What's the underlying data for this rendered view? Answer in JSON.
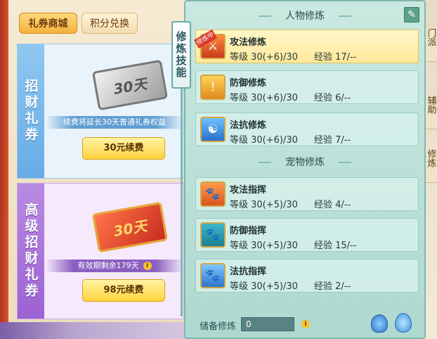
{
  "shop": {
    "tabs": [
      {
        "label": "礼券商城",
        "active": true
      },
      {
        "label": "积分兑换",
        "active": false
      }
    ],
    "cards": [
      {
        "title": "招财礼券",
        "ticket_text": "30天",
        "note": "续费将延长30天普通礼券权益",
        "button": "30元续费"
      },
      {
        "title": "高级招财礼券",
        "ticket_text": "30天",
        "note": "有效期剩余179天",
        "button": "98元续费"
      }
    ]
  },
  "cultivation": {
    "vtab": "修炼技能",
    "character_section": "人物修炼",
    "pet_section": "宠物修炼",
    "selected_ribbon": "修炼中",
    "character_skills": [
      {
        "name": "攻法修炼",
        "level": "等级 30(+6)/30",
        "exp": "经验 17/--",
        "icon": "sword-icon"
      },
      {
        "name": "防御修炼",
        "level": "等级 30(+6)/30",
        "exp": "经验 6/--",
        "icon": "shield-icon"
      },
      {
        "name": "法抗修炼",
        "level": "等级 30(+6)/30",
        "exp": "经验 7/--",
        "icon": "taiji-shield-icon"
      }
    ],
    "pet_skills": [
      {
        "name": "攻法指挥",
        "level": "等级 30(+5)/30",
        "exp": "经验 4/--",
        "icon": "paw-attack-icon"
      },
      {
        "name": "防御指挥",
        "level": "等级 30(+5)/30",
        "exp": "经验 15/--",
        "icon": "paw-defense-icon"
      },
      {
        "name": "法抗指挥",
        "level": "等级 30(+5)/30",
        "exp": "经验 2/--",
        "icon": "paw-resist-icon"
      }
    ],
    "reserve_label": "储备修炼",
    "reserve_value": "0"
  },
  "behind_tabs": [
    "门派",
    "辅助",
    "修炼"
  ],
  "colors": {
    "accent": "#f4b23c",
    "panel": "#aed9d0",
    "selected": "#ffe89a"
  }
}
